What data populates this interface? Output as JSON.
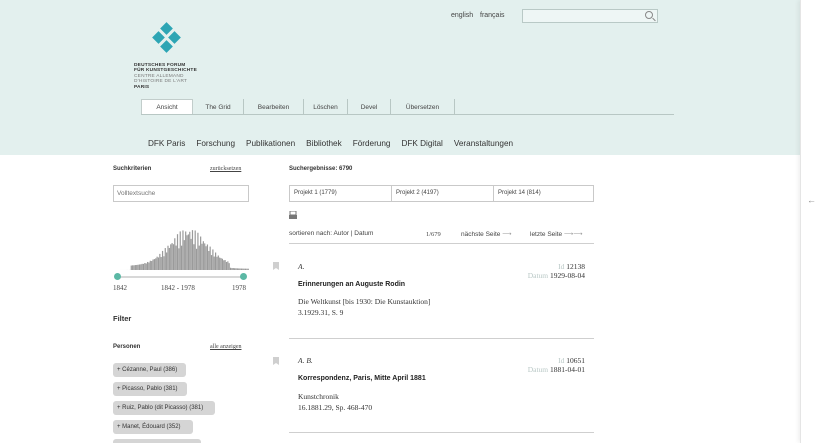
{
  "header": {
    "languages": [
      "english",
      "français"
    ],
    "logo_lines": [
      "DEUTSCHES FORUM",
      "FÜR KUNSTGESCHICHTE",
      "CENTRE ALLEMAND",
      "D'HISTOIRE DE L'ART",
      "PARIS"
    ],
    "tabs": [
      "Ansicht",
      "The Grid",
      "Bearbeiten",
      "Löschen",
      "Devel",
      "Übersetzen"
    ],
    "nav": [
      "DFK Paris",
      "Forschung",
      "Publikationen",
      "Bibliothek",
      "Förderung",
      "DFK Digital",
      "Veranstaltungen"
    ]
  },
  "sidebar": {
    "criteria_label": "Suchkriterien",
    "reset_label": "zurücksetzen",
    "fulltext_placeholder": "Volltextsuche",
    "range_min": "1842",
    "range_mid": "1842 - 1978",
    "range_max": "1978",
    "filter_label": "Filter",
    "persons_label": "Personen",
    "show_all_label": "alle anzeigen",
    "persons": [
      "+ Cézanne, Paul (386)",
      "+ Picasso, Pablo (381)",
      "+ Ruiz, Pablo (dit Picasso) (381)",
      "+ Manet, Édouard (352)"
    ]
  },
  "results": {
    "count_label": "Suchergebnisse: 6790",
    "projects": [
      "Projekt 1 (1779)",
      "Projekt 2 (4197)",
      "Projekt 14 (814)"
    ],
    "sort_label": "sortieren nach: Autor | Datum",
    "page": "1/679",
    "next_label": "nächste Seite",
    "last_label": "letzte Seite",
    "items": [
      {
        "author": "A.",
        "id_label": "Id",
        "id": "12138",
        "date_label": "Datum",
        "date": "1929-08-04",
        "title": "Erinnerungen an Auguste Rodin",
        "source_line1": "Die Weltkunst [bis 1930: Die Kunstauktion]",
        "source_line2": "3.1929.31, S. 9"
      },
      {
        "author": "A. B.",
        "id_label": "Id",
        "id": "10651",
        "date_label": "Datum",
        "date": "1881-04-01",
        "title": "Korrespondenz, Paris, Mitte April 1881",
        "source_line1": "Kunstchronik",
        "source_line2": "16.1881.29, Sp. 468-470"
      }
    ]
  },
  "colors": {
    "header_bg": "#e3f0ee",
    "logo_teal": "#2da5b4",
    "slider_knob": "#5bb8a5"
  }
}
